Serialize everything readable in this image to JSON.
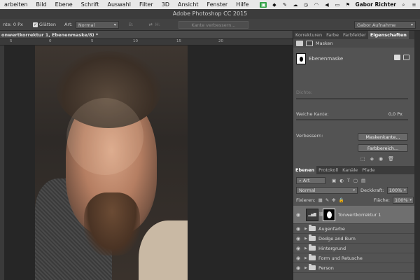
{
  "menubar": {
    "items": [
      "arbeiten",
      "Bild",
      "Ebene",
      "Schrift",
      "Auswahl",
      "Filter",
      "3D",
      "Ansicht",
      "Fenster",
      "Hilfe"
    ],
    "user": "Gabor Richter",
    "icons": [
      "photoshop-status-icon",
      "dropbox-icon",
      "evernote-icon",
      "cloud-icon",
      "time-machine-icon",
      "wifi-icon",
      "sound-icon",
      "battery-icon",
      "flag-icon",
      "search-icon",
      "menu-list-icon"
    ]
  },
  "window": {
    "title": "Adobe Photoshop CC 2015"
  },
  "options": {
    "kante_label": "nte: 0 Px",
    "glaetten_label": "Glätten",
    "art_label": "Art:",
    "art_value": "Normal",
    "b_label": "B:",
    "h_label": "H:",
    "refine_button": "Kante verbessern...",
    "workspace_value": "Gabor Aufnahme"
  },
  "document": {
    "tab_title": "onwertkorrektur 1, Ebenenmaske/8) *",
    "ruler_labels": [
      "5",
      "0",
      "5",
      "10",
      "15",
      "20"
    ]
  },
  "panels": {
    "tabs": [
      "Korrekturen",
      "Farbe",
      "Farbfelder",
      "Eigenschaften"
    ],
    "active_tab": "Eigenschaften",
    "properties": {
      "header": "Masken",
      "mask_name": "Ebenenmaske",
      "dichte_label": "Dichte:",
      "weiche_kante_label": "Weiche Kante:",
      "weiche_kante_value": "0,0 Px",
      "verbessern_label": "Verbessern:",
      "maskenkante_button": "Maskenkante...",
      "farbbereich_button": "Farbbereich..."
    },
    "layers_tabs": [
      "Ebenen",
      "Protokoll",
      "Kanäle",
      "Pfade"
    ],
    "layers_active_tab": "Ebenen",
    "filter_kind": "Art",
    "blend_mode": "Normal",
    "deckkraft_label": "Deckkraft:",
    "deckkraft_value": "100%",
    "fixieren_label": "Fixieren:",
    "flaeche_label": "Fläche:",
    "flaeche_value": "100%",
    "layers": [
      {
        "name": "Tonwertkorrektur 1",
        "type": "adjustment",
        "selected": true
      },
      {
        "name": "Augenfarbe",
        "type": "group"
      },
      {
        "name": "Dodge and Burn",
        "type": "group"
      },
      {
        "name": "Hintergrund",
        "type": "group"
      },
      {
        "name": "Form und Retusche",
        "type": "group"
      },
      {
        "name": "Person",
        "type": "group"
      }
    ]
  }
}
